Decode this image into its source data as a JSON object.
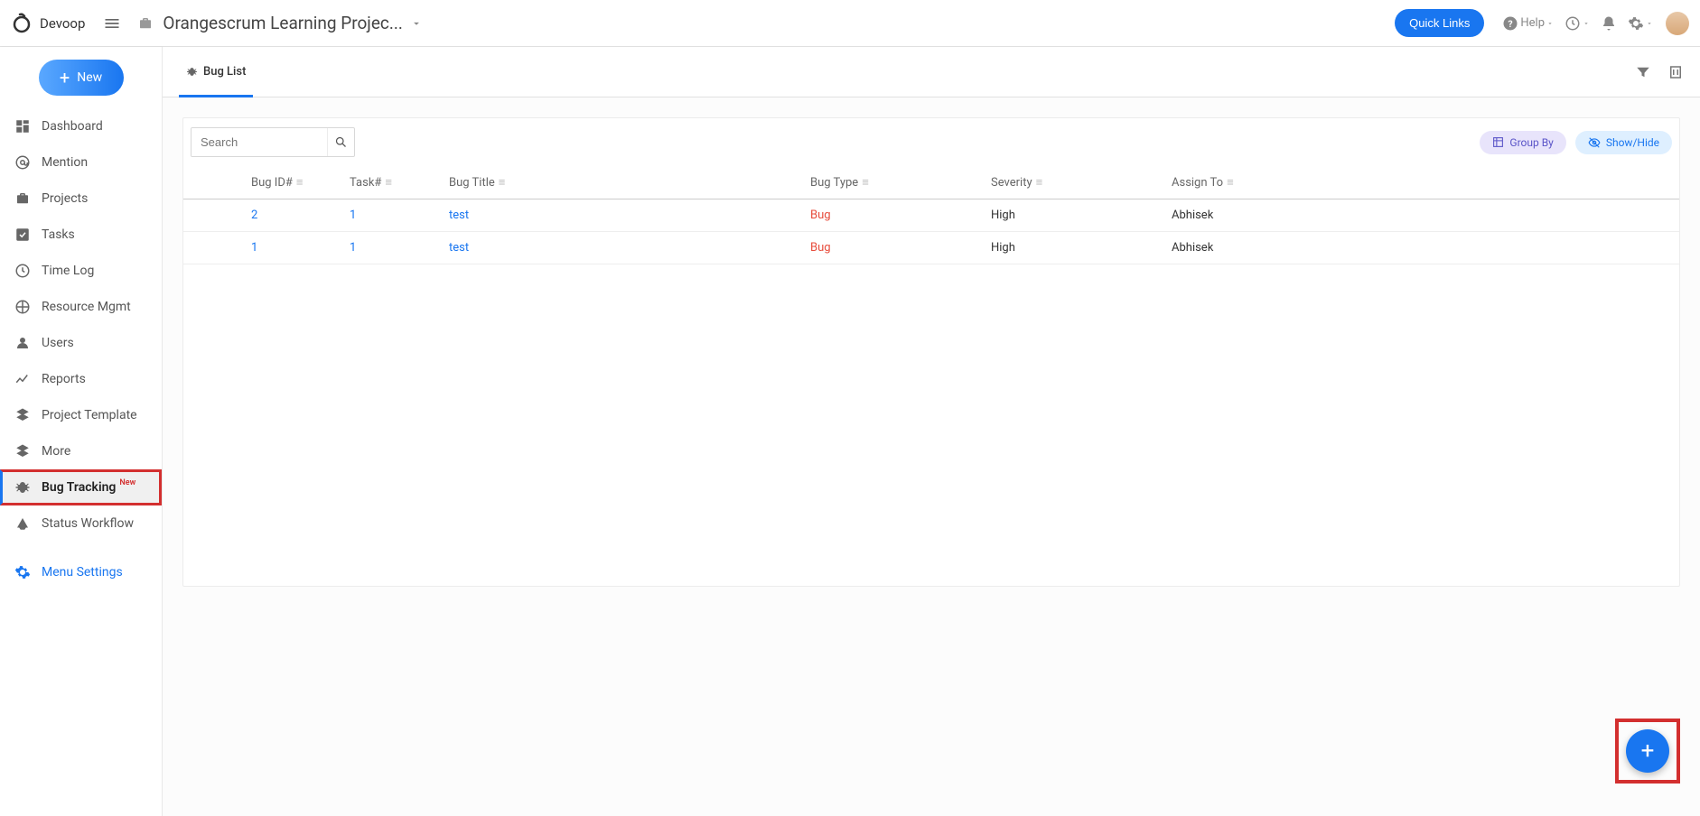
{
  "topbar": {
    "workspace": "Devoop",
    "project": "Orangescrum Learning Projec...",
    "quick_links": "Quick Links",
    "help": "Help"
  },
  "sidebar": {
    "new_label": "New",
    "items": [
      {
        "icon": "dashboard",
        "label": "Dashboard"
      },
      {
        "icon": "mention",
        "label": "Mention"
      },
      {
        "icon": "projects",
        "label": "Projects"
      },
      {
        "icon": "tasks",
        "label": "Tasks"
      },
      {
        "icon": "timelog",
        "label": "Time Log"
      },
      {
        "icon": "resource",
        "label": "Resource Mgmt"
      },
      {
        "icon": "users",
        "label": "Users"
      },
      {
        "icon": "reports",
        "label": "Reports"
      },
      {
        "icon": "template",
        "label": "Project Template"
      },
      {
        "icon": "more",
        "label": "More"
      },
      {
        "icon": "bug",
        "label": "Bug Tracking",
        "badge": "New",
        "active": true
      },
      {
        "icon": "workflow",
        "label": "Status Workflow"
      }
    ],
    "settings_label": "Menu Settings"
  },
  "tabs": {
    "bug_list": "Bug List"
  },
  "panel": {
    "search_placeholder": "Search",
    "group_by": "Group By",
    "show_hide": "Show/Hide",
    "columns": {
      "bug_id": "Bug ID#",
      "task": "Task#",
      "title": "Bug Title",
      "type": "Bug Type",
      "severity": "Severity",
      "assign": "Assign To"
    },
    "rows": [
      {
        "id": "2",
        "task": "1",
        "title": "test",
        "type": "Bug",
        "severity": "High",
        "assign": "Abhisek"
      },
      {
        "id": "1",
        "task": "1",
        "title": "test",
        "type": "Bug",
        "severity": "High",
        "assign": "Abhisek"
      }
    ]
  }
}
